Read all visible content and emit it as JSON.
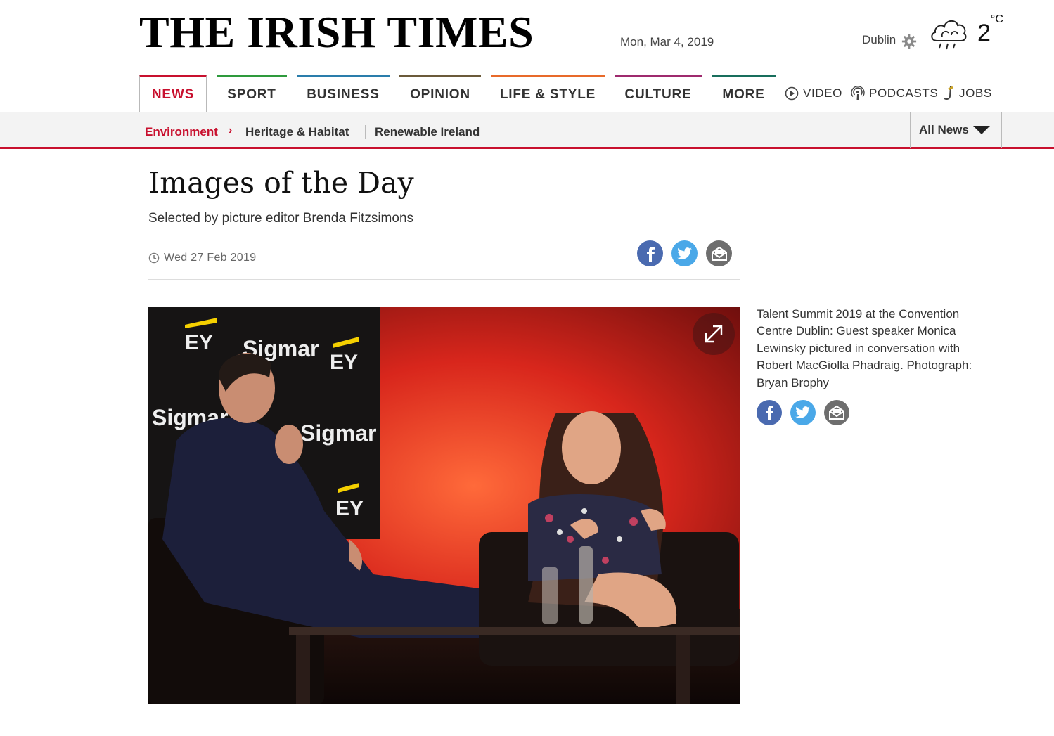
{
  "masthead": {
    "logo": "THE IRISH TIMES",
    "date": "Mon, Mar 4, 2019",
    "weather_location": "Dublin",
    "temperature": "2",
    "temperature_unit": "°C",
    "weather_icon": "cloud-rain-icon"
  },
  "nav": {
    "items": [
      {
        "label": "NEWS",
        "color": "#c8102e"
      },
      {
        "label": "SPORT",
        "color": "#2e9a3c"
      },
      {
        "label": "BUSINESS",
        "color": "#2a7dab"
      },
      {
        "label": "OPINION",
        "color": "#6b5a3a"
      },
      {
        "label": "LIFE & STYLE",
        "color": "#e86a2a"
      },
      {
        "label": "CULTURE",
        "color": "#9e2a6e"
      },
      {
        "label": "MORE",
        "color": "#186e5c"
      }
    ],
    "extras": [
      {
        "label": "VIDEO",
        "icon": "play-circle-icon"
      },
      {
        "label": "PODCASTS",
        "icon": "podcast-icon"
      },
      {
        "label": "JOBS",
        "icon": "jobs-icon"
      }
    ]
  },
  "subnav": {
    "current": "Environment",
    "items": [
      "Heritage & Habitat",
      "Renewable Ireland"
    ],
    "all_news": "All News"
  },
  "article": {
    "title": "Images of the Day",
    "subtitle": "Selected by picture editor Brenda Fitzsimons",
    "date": "Wed 27 Feb 2019",
    "photo_wall_text": [
      "EY",
      "Sigmar"
    ],
    "caption": "Talent Summit 2019 at the Convention Centre Dublin: Guest speaker Monica Lewinsky pictured in conversation with Robert MacGiolla Phadraig. Photograph: Bryan Brophy"
  },
  "share": {
    "facebook_color": "#4a6ab0",
    "twitter_color": "#4aa8e8",
    "email_color": "#6e6e6e"
  }
}
